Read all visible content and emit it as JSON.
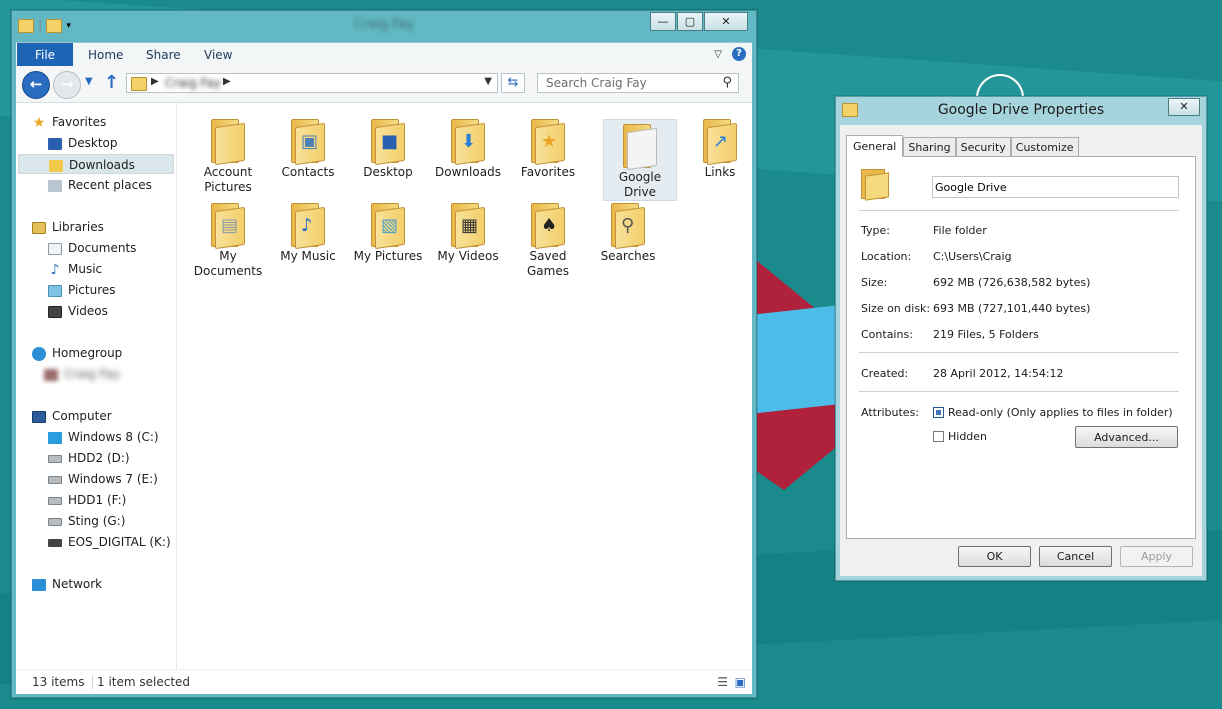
{
  "explorer": {
    "title": "Craig Fay",
    "window_buttons": {
      "minimize": "—",
      "maximize": "▢",
      "close": "✕"
    },
    "ribbon_tabs": [
      "File",
      "Home",
      "Share",
      "View"
    ],
    "address": {
      "crumb": "Craig Fay"
    },
    "search": {
      "placeholder": "Search Craig Fay"
    },
    "nav": {
      "favorites": {
        "label": "Favorites",
        "items": [
          "Desktop",
          "Downloads",
          "Recent places"
        ]
      },
      "libraries": {
        "label": "Libraries",
        "items": [
          "Documents",
          "Music",
          "Pictures",
          "Videos"
        ]
      },
      "homegroup": {
        "label": "Homegroup",
        "user": "Craig Fay"
      },
      "computer": {
        "label": "Computer",
        "items": [
          "Windows 8 (C:)",
          "HDD2 (D:)",
          "Windows 7 (E:)",
          "HDD1 (F:)",
          "Sting (G:)",
          "EOS_DIGITAL (K:)"
        ]
      },
      "network": {
        "label": "Network"
      }
    },
    "folders": [
      {
        "line1": "Account",
        "line2": "Pictures"
      },
      {
        "line1": "Contacts",
        "line2": ""
      },
      {
        "line1": "Desktop",
        "line2": ""
      },
      {
        "line1": "Downloads",
        "line2": ""
      },
      {
        "line1": "Favorites",
        "line2": ""
      },
      {
        "line1": "Google",
        "line2": "Drive"
      },
      {
        "line1": "Links",
        "line2": ""
      },
      {
        "line1": "My",
        "line2": "Documents"
      },
      {
        "line1": "My Music",
        "line2": ""
      },
      {
        "line1": "My Pictures",
        "line2": ""
      },
      {
        "line1": "My Videos",
        "line2": ""
      },
      {
        "line1": "Saved",
        "line2": "Games"
      },
      {
        "line1": "Searches",
        "line2": ""
      }
    ],
    "status": {
      "count": "13 items",
      "selected": "1 item selected"
    }
  },
  "dialog": {
    "title": "Google Drive Properties",
    "close": "✕",
    "tabs": [
      "General",
      "Sharing",
      "Security",
      "Customize"
    ],
    "name": "Google Drive",
    "type_label": "Type:",
    "type_value": "File folder",
    "location_label": "Location:",
    "location_value": "C:\\Users\\Craig",
    "size_label": "Size:",
    "size_value": "692 MB (726,638,582 bytes)",
    "sizeondisk_label": "Size on disk:",
    "sizeondisk_value": "693 MB (727,101,440 bytes)",
    "contains_label": "Contains:",
    "contains_value": "219 Files, 5 Folders",
    "created_label": "Created:",
    "created_value": "28 April 2012, 14:54:12",
    "attributes_label": "Attributes:",
    "readonly_label": "Read-only (Only applies to files in folder)",
    "hidden_label": "Hidden",
    "advanced_label": "Advanced...",
    "ok_label": "OK",
    "cancel_label": "Cancel",
    "apply_label": "Apply"
  }
}
